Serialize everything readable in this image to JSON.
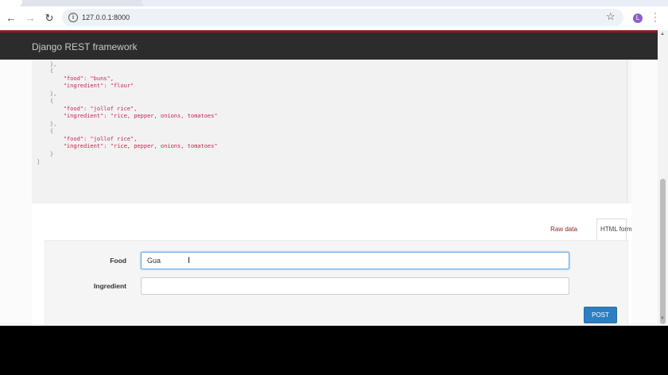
{
  "browser": {
    "url": "127.0.0.1:8000",
    "profile_initial": "L",
    "icons": {
      "back": "arrow-left-icon",
      "forward": "arrow-right-icon",
      "reload": "reload-icon",
      "site_info": "info-icon",
      "bookmark": "star-icon",
      "menu": "kebab-menu-icon"
    }
  },
  "navbar": {
    "brand": "Django REST framework",
    "accent_color": "#8d1d1d",
    "background_color": "#2c2c2c"
  },
  "response_lines": [
    {
      "text": "    },",
      "kind": "punct"
    },
    {
      "text": "    {",
      "kind": "punct"
    },
    {
      "text": "        \"food\": \"buns\",",
      "kind": "str"
    },
    {
      "text": "        \"ingredient\": \"flour\"",
      "kind": "str"
    },
    {
      "text": "    },",
      "kind": "punct"
    },
    {
      "text": "    {",
      "kind": "punct"
    },
    {
      "text": "        \"food\": \"jollof rice\",",
      "kind": "str"
    },
    {
      "text": "        \"ingredient\": \"rice, pepper, onions, tomatoes\"",
      "kind": "str"
    },
    {
      "text": "    },",
      "kind": "punct"
    },
    {
      "text": "    {",
      "kind": "punct"
    },
    {
      "text": "        \"food\": \"jollof rice\",",
      "kind": "str"
    },
    {
      "text": "        \"ingredient\": \"rice, pepper, onions, tomatoes\"",
      "kind": "str"
    },
    {
      "text": "    }",
      "kind": "punct"
    },
    {
      "text": "]",
      "kind": "punct"
    }
  ],
  "tabs": {
    "raw_data": "Raw data",
    "html_form": "HTML form"
  },
  "form": {
    "food_label": "Food",
    "food_value": "Gua",
    "ingredient_label": "Ingredient",
    "ingredient_value": "",
    "submit_label": "POST"
  }
}
